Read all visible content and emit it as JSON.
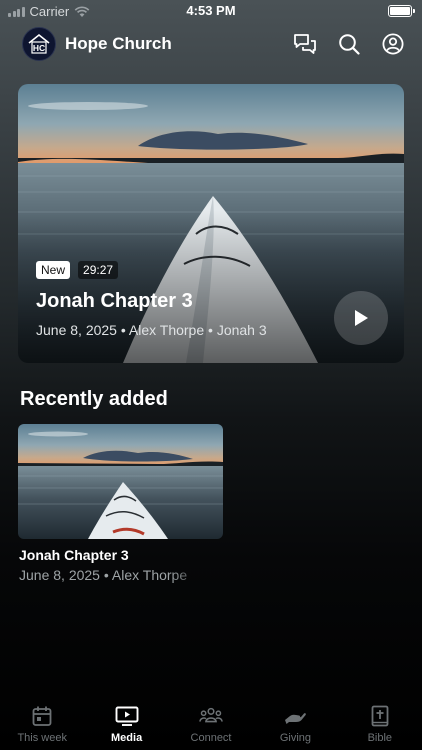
{
  "status_bar": {
    "carrier": "Carrier",
    "time": "4:53 PM"
  },
  "header": {
    "title": "Hope Church",
    "logo_text": "HC"
  },
  "hero": {
    "badge_new": "New",
    "duration": "29:27",
    "title": "Jonah Chapter 3",
    "date": "June 8, 2025",
    "speaker": "Alex Thorpe",
    "series": "Jonah 3"
  },
  "recent": {
    "section_title": "Recently added",
    "items": [
      {
        "title": "Jonah Chapter 3",
        "date": "June 8, 2025",
        "speaker": "Alex Thorpe"
      }
    ]
  },
  "separator": "•",
  "tabs": [
    {
      "label": "This week",
      "icon": "calendar-icon",
      "active": false
    },
    {
      "label": "Media",
      "icon": "tv-play-icon",
      "active": true
    },
    {
      "label": "Connect",
      "icon": "people-icon",
      "active": false
    },
    {
      "label": "Giving",
      "icon": "giving-hand-icon",
      "active": false
    },
    {
      "label": "Bible",
      "icon": "bible-icon",
      "active": false
    }
  ],
  "colors": {
    "accent": "#ffffff",
    "inactive": "#6d7275",
    "logo_bg": "#0e1530"
  }
}
